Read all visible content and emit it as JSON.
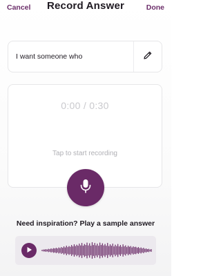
{
  "nav": {
    "cancel_label": "Cancel",
    "title": "Record Answer",
    "done_label": "Done"
  },
  "prompt": {
    "text": "I want someone who",
    "edit_icon": "pencil-icon"
  },
  "recorder": {
    "timer": "0:00 / 0:30",
    "hint": "Tap to start recording",
    "record_icon": "microphone-icon"
  },
  "sample": {
    "heading": "Need inspiration? Play a sample answer",
    "play_icon": "play-icon"
  },
  "colors": {
    "accent": "#6a2a67",
    "nav_link": "#6c2e6a",
    "player_bg": "#ece9ee",
    "waveform": "#6a2a67"
  }
}
